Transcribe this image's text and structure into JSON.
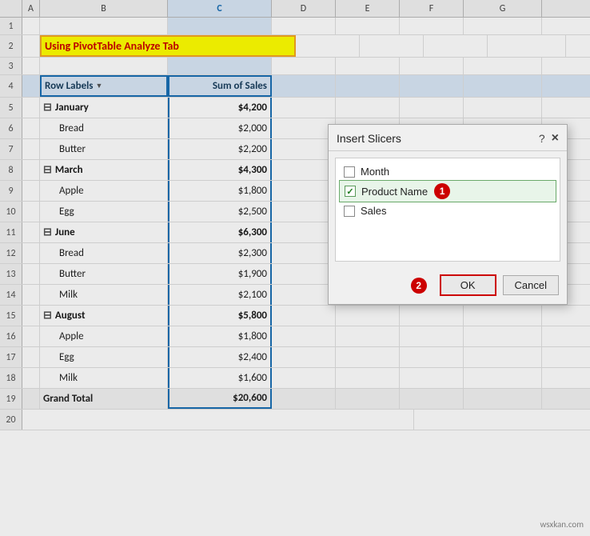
{
  "columns": {
    "widths": [
      28,
      22,
      160,
      130,
      80,
      80,
      80,
      80
    ],
    "labels": [
      "",
      "A",
      "B",
      "C",
      "D",
      "E",
      "F",
      "G"
    ],
    "selected": 2
  },
  "title": {
    "text": "Using PivotTable Analyze Tab",
    "row": 2
  },
  "pivot": {
    "headers": {
      "rowLabels": "Row Labels",
      "sumOfSales": "Sum of Sales"
    },
    "rows": [
      {
        "type": "group",
        "label": "January",
        "value": "$4,200"
      },
      {
        "type": "item",
        "label": "Bread",
        "value": "$2,000"
      },
      {
        "type": "item",
        "label": "Butter",
        "value": "$2,200"
      },
      {
        "type": "group",
        "label": "March",
        "value": "$4,300"
      },
      {
        "type": "item",
        "label": "Apple",
        "value": "$1,800"
      },
      {
        "type": "item",
        "label": "Egg",
        "value": "$2,500"
      },
      {
        "type": "group",
        "label": "June",
        "value": "$6,300"
      },
      {
        "type": "item",
        "label": "Bread",
        "value": "$2,300"
      },
      {
        "type": "item",
        "label": "Butter",
        "value": "$1,900"
      },
      {
        "type": "item",
        "label": "Milk",
        "value": "$2,100"
      },
      {
        "type": "group",
        "label": "August",
        "value": "$5,800"
      },
      {
        "type": "item",
        "label": "Apple",
        "value": "$1,800"
      },
      {
        "type": "item",
        "label": "Egg",
        "value": "$2,400"
      },
      {
        "type": "item",
        "label": "Milk",
        "value": "$1,600"
      },
      {
        "type": "total",
        "label": "Grand Total",
        "value": "$20,600"
      }
    ]
  },
  "row_numbers": [
    1,
    2,
    3,
    4,
    5,
    6,
    7,
    8,
    9,
    10,
    11,
    12,
    13,
    14,
    15,
    16,
    17,
    18,
    19
  ],
  "dialog": {
    "title": "Insert Slicers",
    "help_label": "?",
    "close_label": "×",
    "items": [
      {
        "id": "month",
        "label": "Month",
        "checked": false
      },
      {
        "id": "product_name",
        "label": "Product Name",
        "checked": true
      },
      {
        "id": "sales",
        "label": "Sales",
        "checked": false
      }
    ],
    "badge1": "1",
    "badge2": "2",
    "ok_label": "OK",
    "cancel_label": "Cancel"
  },
  "watermark": "wsxkan.com"
}
